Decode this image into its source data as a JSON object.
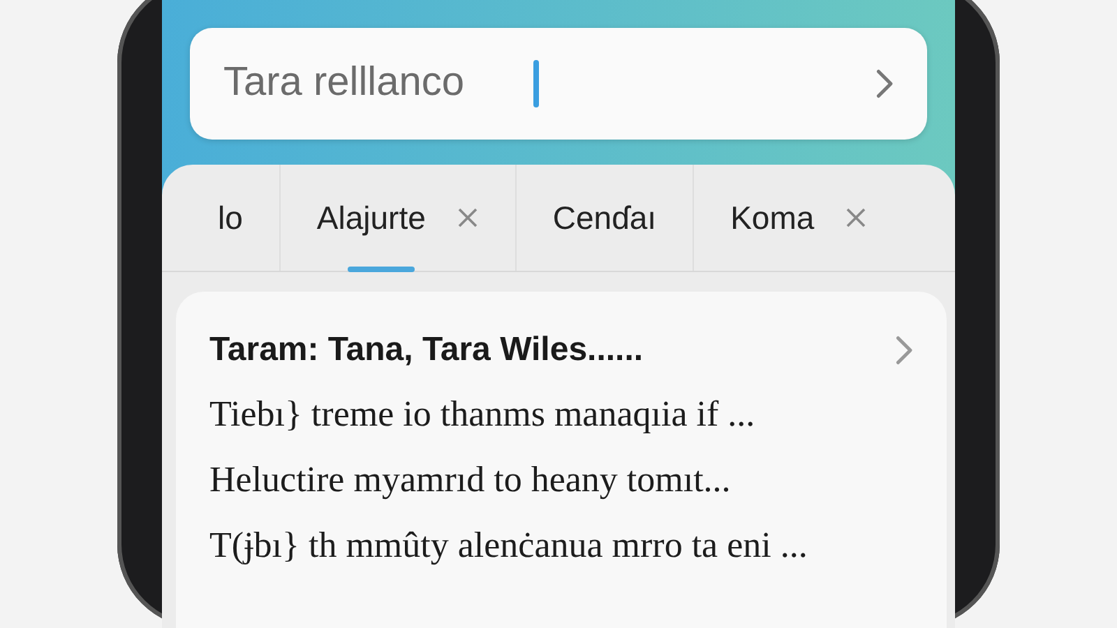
{
  "search": {
    "value": "Tara relllanco"
  },
  "tabs": [
    {
      "label": "lo",
      "closable": false,
      "selected": false
    },
    {
      "label": "Alajurte",
      "closable": true,
      "selected": true
    },
    {
      "label": "Cenɗaı",
      "closable": false,
      "selected": false
    },
    {
      "label": "Koma",
      "closable": true,
      "selected": false
    }
  ],
  "result": {
    "title": "Taram: Tana, Tara Wiles......",
    "lines": [
      "Tiebı} treme io thanms manaqıia if ...",
      "Heluctire myamrıd to heany tomıt...",
      "T(ɉbı} th mmûty alenċanua mrro ta eni ..."
    ]
  }
}
